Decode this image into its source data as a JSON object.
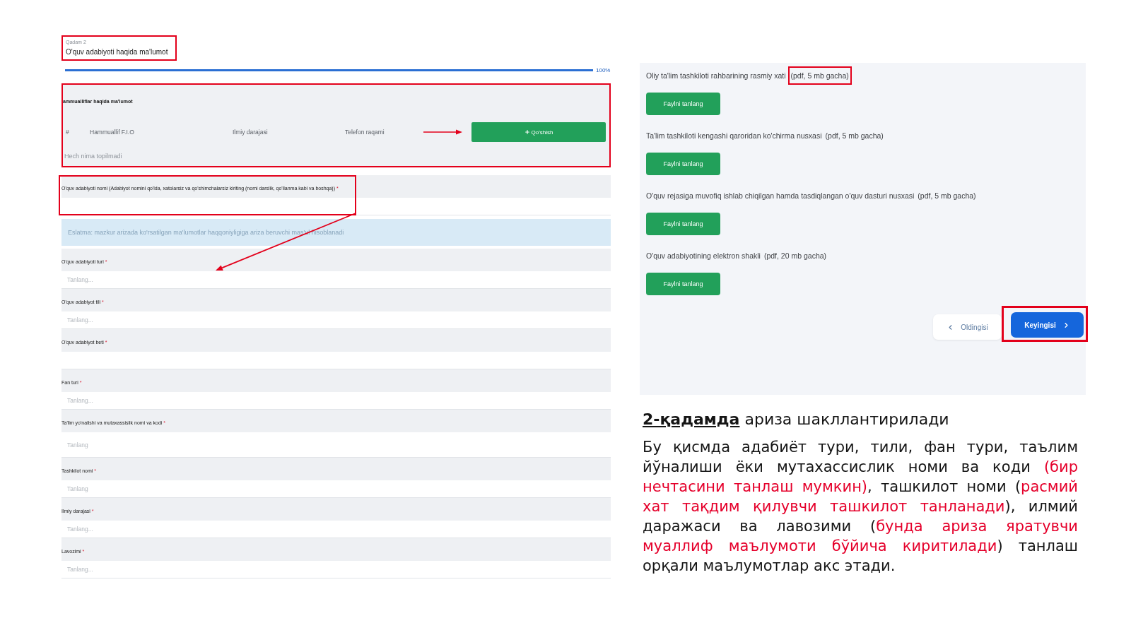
{
  "step": {
    "caption": "Qadam 2",
    "title": "O'quv adabiyoti haqida ma'lumot",
    "highlighted": true
  },
  "progress": {
    "level": 1,
    "reading": "100%"
  },
  "coauthors": {
    "title": "ammualliflar haqida ma'lumot",
    "highlighted": true,
    "columns": [
      "#",
      "Hammuallif F.I.O",
      "Ilmiy darajasi",
      "Telefon raqami"
    ],
    "add_button": "Qo'shish",
    "empty_text": "Hech nima topilmadi"
  },
  "form": [
    {
      "kind": "text",
      "label": "O'quv adabiyoti nomi (Adabiyot nomini qo'lda, xatolarsiz va qo'shimchalarsiz kiriting (nomi darslik, qo'llanma kabi va boshqa))",
      "required_mark": "*",
      "highlighted": true
    },
    {
      "kind": "notice",
      "text": "Eslatma: mazkur arizada ko'rsatilgan ma'lumotlar haqqoniyligiga ariza beruvchi mas'ul hisoblanadi"
    },
    {
      "kind": "select",
      "label": "O'quv adabiyoti turi",
      "required_mark": "*",
      "placeholder": "Tanlang...",
      "highlighted": false
    },
    {
      "kind": "select",
      "label": "O'quv adabiyot tili",
      "required_mark": "*",
      "placeholder": "Tanlang...",
      "highlighted": false
    },
    {
      "kind": "text",
      "label": "O'quv adabiyot beti",
      "required_mark": "*",
      "highlighted": false
    },
    {
      "kind": "select",
      "label": "Fan turi",
      "required_mark": "*",
      "placeholder": "Tanlang...",
      "highlighted": false
    },
    {
      "kind": "multiselect",
      "label": "Ta'lim yo'nalishi va mutaxassislik nomi va kodi",
      "required_mark": "*",
      "placeholder": "Tanlang",
      "highlighted": false
    },
    {
      "kind": "select",
      "label": "Tashkilot nomi",
      "required_mark": "*",
      "placeholder": "Tanlang",
      "highlighted": false
    },
    {
      "kind": "select",
      "label": "Ilmiy darajasi",
      "required_mark": "*",
      "placeholder": "Tanlang...",
      "highlighted": false
    },
    {
      "kind": "select",
      "label": "Lavozimi",
      "required_mark": "*",
      "placeholder": "Tanlang...",
      "highlighted": false
    }
  ],
  "attachments": [
    {
      "label": "Oliy ta'lim tashkiloti rahbarining rasmiy xati",
      "note": "(pdf, 5 mb gacha)",
      "highlighted": true,
      "button": "Faylni tanlang"
    },
    {
      "label": "Ta'lim tashkiloti kengashi qaroridan ko'chirma nusxasi",
      "note": "(pdf, 5 mb gacha)",
      "highlighted": false,
      "button": "Faylni tanlang"
    },
    {
      "label": "O'quv rejasiga muvofiq ishlab chiqilgan hamda tasdiqlangan o'quv dasturi nusxasi",
      "note": "(pdf, 5 mb gacha)",
      "highlighted": false,
      "button": "Faylni tanlang"
    },
    {
      "label": "O'quv adabiyotining elektron shakli",
      "note": "(pdf, 20 mb gacha)",
      "highlighted": false,
      "button": "Faylni tanlang"
    }
  ],
  "navigation": [
    {
      "kind": "prev",
      "label": "Oldingisi",
      "highlighted": false
    },
    {
      "kind": "next",
      "label": "Keyingisi",
      "highlighted": true
    }
  ],
  "explanation": {
    "heading": "**2-қадамда** ариза шакллантирилади",
    "paragraph": [
      {
        "text": "Бу қисмда адабиёт тури, тили, фан тури, таълим йўналиши ёки мутахассислик номи ва коди ",
        "emphasis": false
      },
      {
        "text": "(бир нечтасини танлаш мумкин)",
        "emphasis": true
      },
      {
        "text": ", ташкилот номи (",
        "emphasis": false
      },
      {
        "text": "расмий хат тақдим қилувчи ташкилот танланади",
        "emphasis": true
      },
      {
        "text": "), илмий даражаси ва лавозими (",
        "emphasis": false
      },
      {
        "text": "бунда ариза яратувчи муаллиф маълумоти бўйича киритилади",
        "emphasis": true
      },
      {
        "text": ") танлаш орқали маълумотлар акс этади.",
        "emphasis": false
      }
    ]
  }
}
